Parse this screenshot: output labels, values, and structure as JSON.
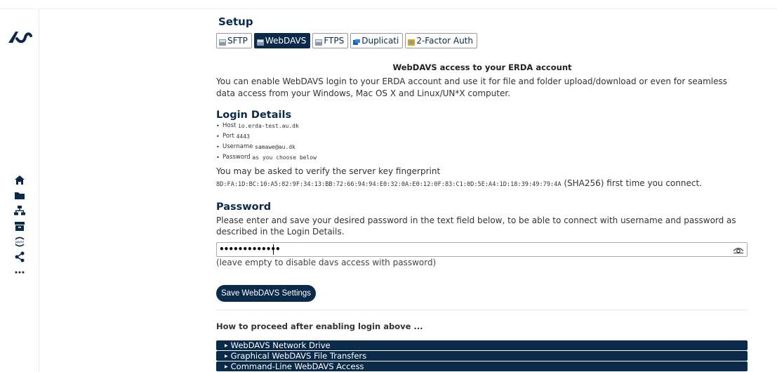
{
  "sidebar": {
    "logo": "au-logo",
    "icons": [
      "home-icon",
      "folder-icon",
      "network-icon",
      "archive-icon",
      "jupyter-icon",
      "share-icon",
      "more-icon"
    ],
    "jupyter_text": "jupyter"
  },
  "setup": {
    "title": "Setup",
    "tabs": [
      {
        "label": "SFTP",
        "active": false
      },
      {
        "label": "WebDAVS",
        "active": true
      },
      {
        "label": "FTPS",
        "active": false
      },
      {
        "label": "Duplicati",
        "active": false
      },
      {
        "label": "2-Factor Auth",
        "active": false
      }
    ]
  },
  "webdavs": {
    "section_title": "WebDAVS access to your ERDA account",
    "intro": "You can enable WebDAVS login to your ERDA account and use it for file and folder upload/download or even for seamless data access from your Windows, Mac OS X and Linux/UN*X computer.",
    "login_heading": "Login Details",
    "details": [
      {
        "label": "Host",
        "value": "io.erda-test.au.dk"
      },
      {
        "label": "Port",
        "value": "4443"
      },
      {
        "label": "Username",
        "value": "samawe@au.dk"
      },
      {
        "label": "Password",
        "value": "as you choose below"
      }
    ],
    "verify_text": "You may be asked to verify the server key fingerprint",
    "fingerprint": "8D:FA:1D:BC:10:A5:82:9F:34:13:BB:72:66:94:94:E0:32:0A:E0:12:0F:83:C1:0D:5E:A4:1D:18:39:49:79:4A",
    "fingerprint_suffix": " (SHA256) first time you connect.",
    "password_heading": "Password",
    "password_desc": "Please enter and save your desired password in the text field below, to be able to connect with username and password as described in the Login Details.",
    "password_value": "•••••••••••••",
    "password_hint": "(leave empty to disable davs access with password)",
    "save_label": "Save WebDAVS Settings",
    "proceed_text": "How to proceed after enabling login above ...",
    "accordion": [
      "WebDAVS Network Drive",
      "Graphical WebDAVS File Transfers",
      "Command-Line WebDAVS Access"
    ]
  },
  "colors": {
    "primary": "#0b2a4a"
  }
}
